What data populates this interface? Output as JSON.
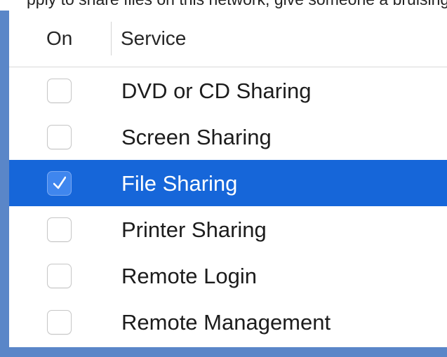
{
  "top_strip_text": "pply to share files on this network, give someone a bruising, ",
  "table": {
    "columns": {
      "on": "On",
      "service": "Service"
    },
    "rows": [
      {
        "service": "DVD or CD Sharing",
        "on": false,
        "selected": false
      },
      {
        "service": "Screen Sharing",
        "on": false,
        "selected": false
      },
      {
        "service": "File Sharing",
        "on": true,
        "selected": true
      },
      {
        "service": "Printer Sharing",
        "on": false,
        "selected": false
      },
      {
        "service": "Remote Login",
        "on": false,
        "selected": false
      },
      {
        "service": "Remote Management",
        "on": false,
        "selected": false
      }
    ]
  },
  "colors": {
    "selection": "#1666d9",
    "frame": "#5a86c8",
    "checkbox_checked": "#3f86ee"
  }
}
